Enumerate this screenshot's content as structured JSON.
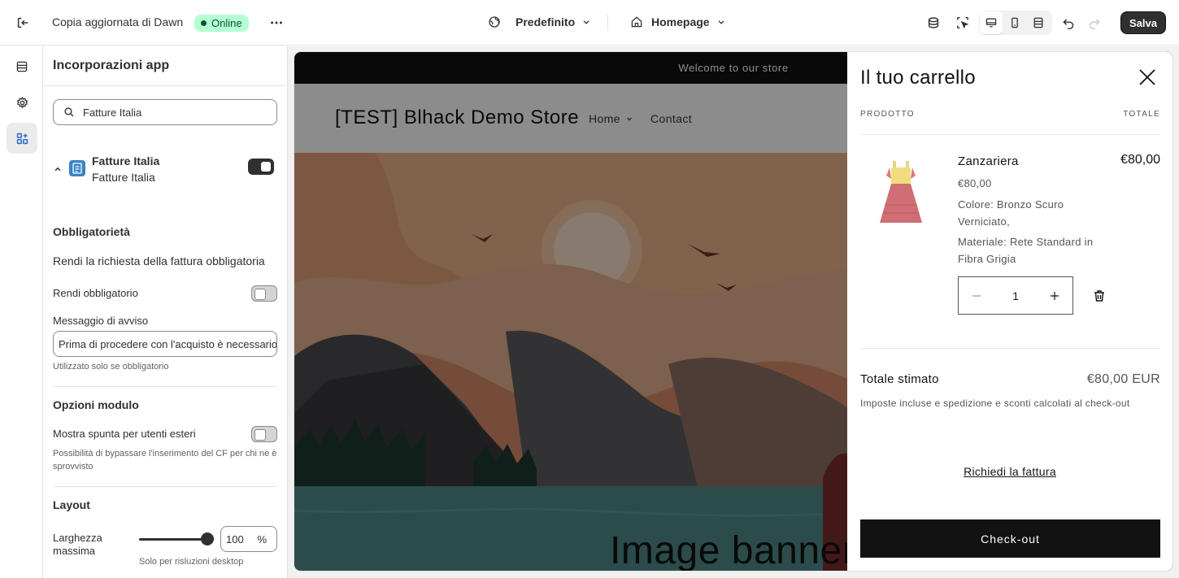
{
  "topbar": {
    "theme_name": "Copia aggiornata di Dawn",
    "status_badge": "Online",
    "preset_label": "Predefinito",
    "page_label": "Homepage",
    "save_label": "Salva"
  },
  "panel": {
    "title": "Incorporazioni app",
    "search_value": "Fatture Italia",
    "app": {
      "name": "Fatture Italia",
      "subtitle": "Fatture Italia",
      "enabled": true
    },
    "section_required": {
      "title": "Obbligatorietà",
      "description": "Rendi la richiesta della fattura obbligatoria",
      "toggle_label": "Rendi obbligatorio",
      "message_label": "Messaggio di avviso",
      "message_value": "Prima di procedere con l'acquisto è necessario",
      "message_help": "Utilizzato solo se obbligatorio"
    },
    "section_form": {
      "title": "Opzioni modulo",
      "toggle_label": "Mostra spunta per utenti esteri",
      "help": "Possibilità di bypassare l'inserimento del CF per chi ne è sprovvisto"
    },
    "section_layout": {
      "title": "Layout",
      "width_label": "Larghezza massima",
      "width_value": "100",
      "width_unit": "%",
      "width_help": "Solo per risluzioni desktop"
    }
  },
  "preview": {
    "announcement": "Welcome to our store",
    "store_name": "[TEST] Blhack Demo Store",
    "nav": [
      "Home",
      "Contact"
    ],
    "banner_heading": "Image banner"
  },
  "cart": {
    "title": "Il tuo carrello",
    "col_product": "PRODOTTO",
    "col_total": "TOTALE",
    "item": {
      "name": "Zanzariera",
      "price": "€80,00",
      "option_color": "Colore: Bronzo Scuro Verniciato,",
      "option_material": "Materiale: Rete Standard in Fibra Grigia",
      "quantity": "1",
      "line_total": "€80,00"
    },
    "estimated_label": "Totale stimato",
    "estimated_value": "€80,00 EUR",
    "tax_note": "Imposte incluse e spedizione e sconti calcolati al check-out",
    "invoice_link": "Richiedi la fattura",
    "checkout_label": "Check-out"
  }
}
